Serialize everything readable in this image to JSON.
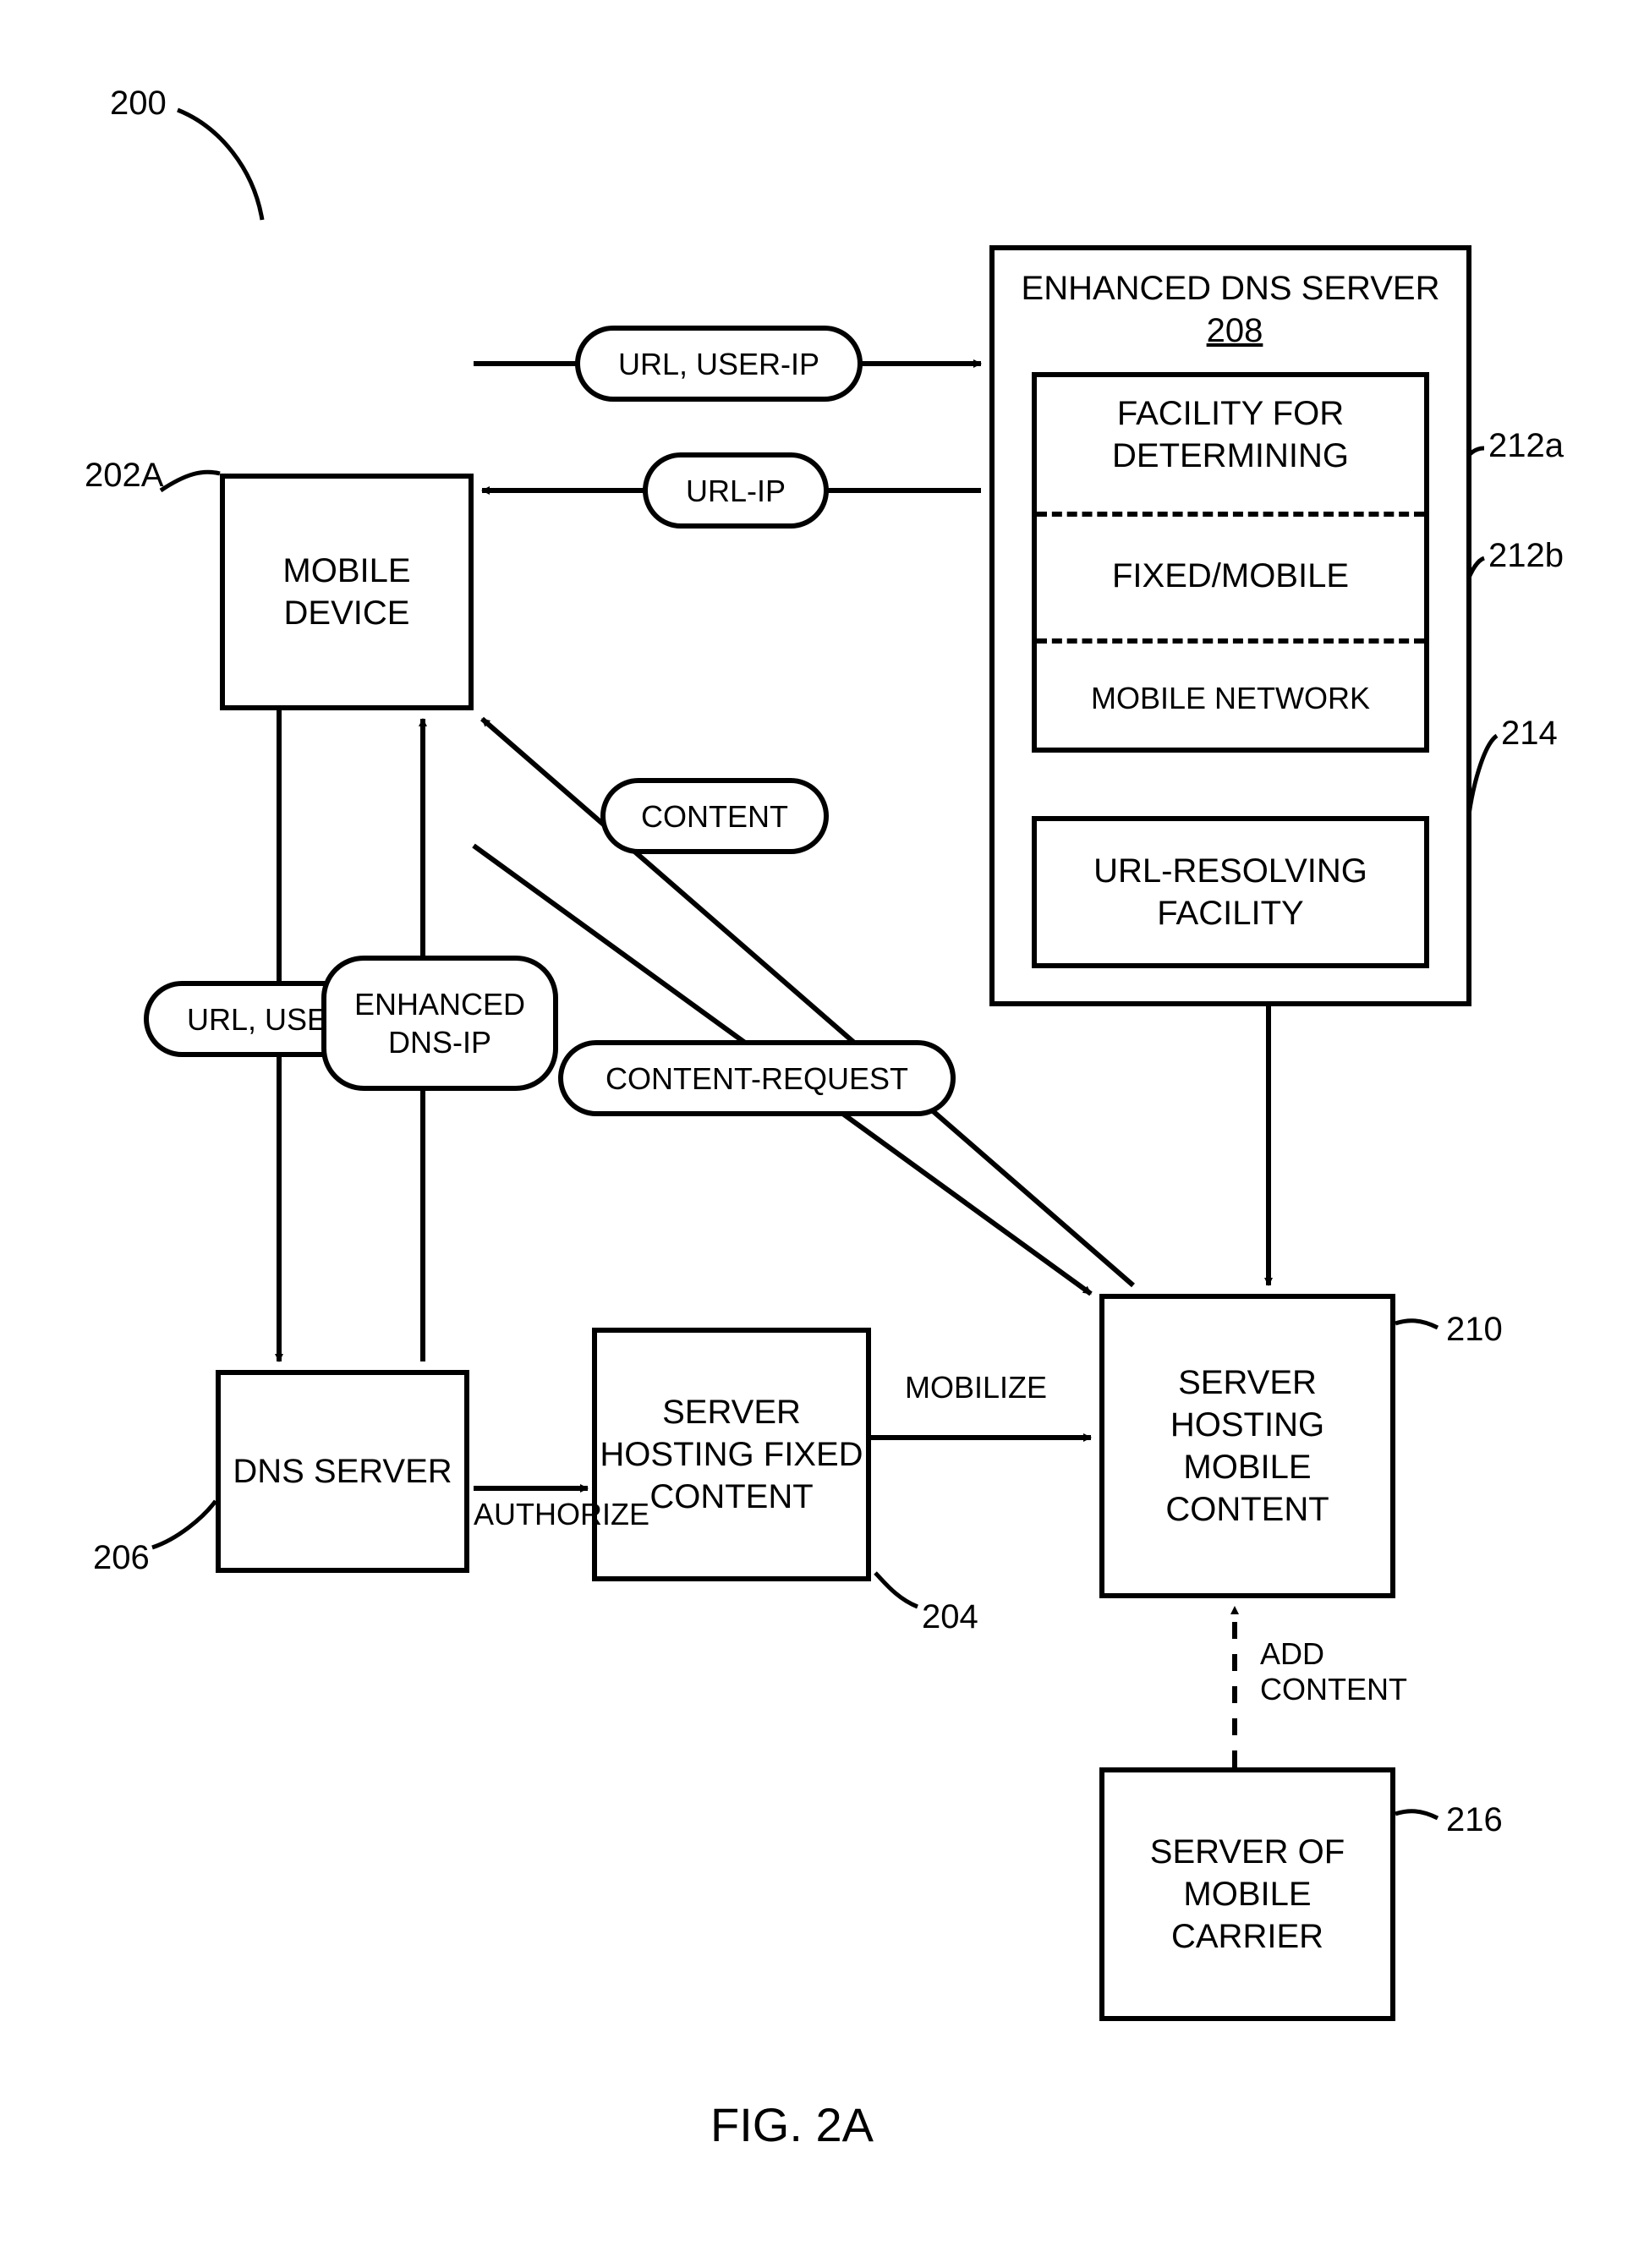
{
  "figure_ref": "200",
  "figure_caption": "FIG. 2A",
  "mobile_device": {
    "ref": "202A",
    "label": "MOBILE\nDEVICE"
  },
  "dns_server": {
    "ref": "206",
    "label": "DNS\nSERVER"
  },
  "fixed_server": {
    "ref": "204",
    "label": "SERVER\nHOSTING\nFIXED\nCONTENT"
  },
  "mobile_content_server": {
    "ref": "210",
    "label": "SERVER\nHOSTING\nMOBILE\nCONTENT"
  },
  "carrier_server": {
    "ref": "216",
    "label": "SERVER\nOF\nMOBILE\nCARRIER"
  },
  "edns": {
    "ref": "208",
    "title": "ENHANCED\nDNS SERVER",
    "facility": {
      "title": "FACILITY FOR\nDETERMINING",
      "fixed_mobile": {
        "ref": "212a",
        "label": "FIXED/MOBILE"
      },
      "mobile_network": {
        "ref": "212b",
        "label": "MOBILE NETWORK"
      }
    },
    "url_resolving": {
      "ref": "214",
      "label": "URL-RESOLVING\nFACILITY"
    }
  },
  "msgs": {
    "url_userip_left": "URL, USER-IP",
    "enhanced_dnsip": "ENHANCED\nDNS-IP",
    "url_userip_top": "URL, USER-IP",
    "url_ip": "URL-IP",
    "content": "CONTENT",
    "content_request": "CONTENT-REQUEST",
    "authorize": "AUTHORIZE",
    "mobilize": "MOBILIZE",
    "add_content": "ADD\nCONTENT"
  }
}
